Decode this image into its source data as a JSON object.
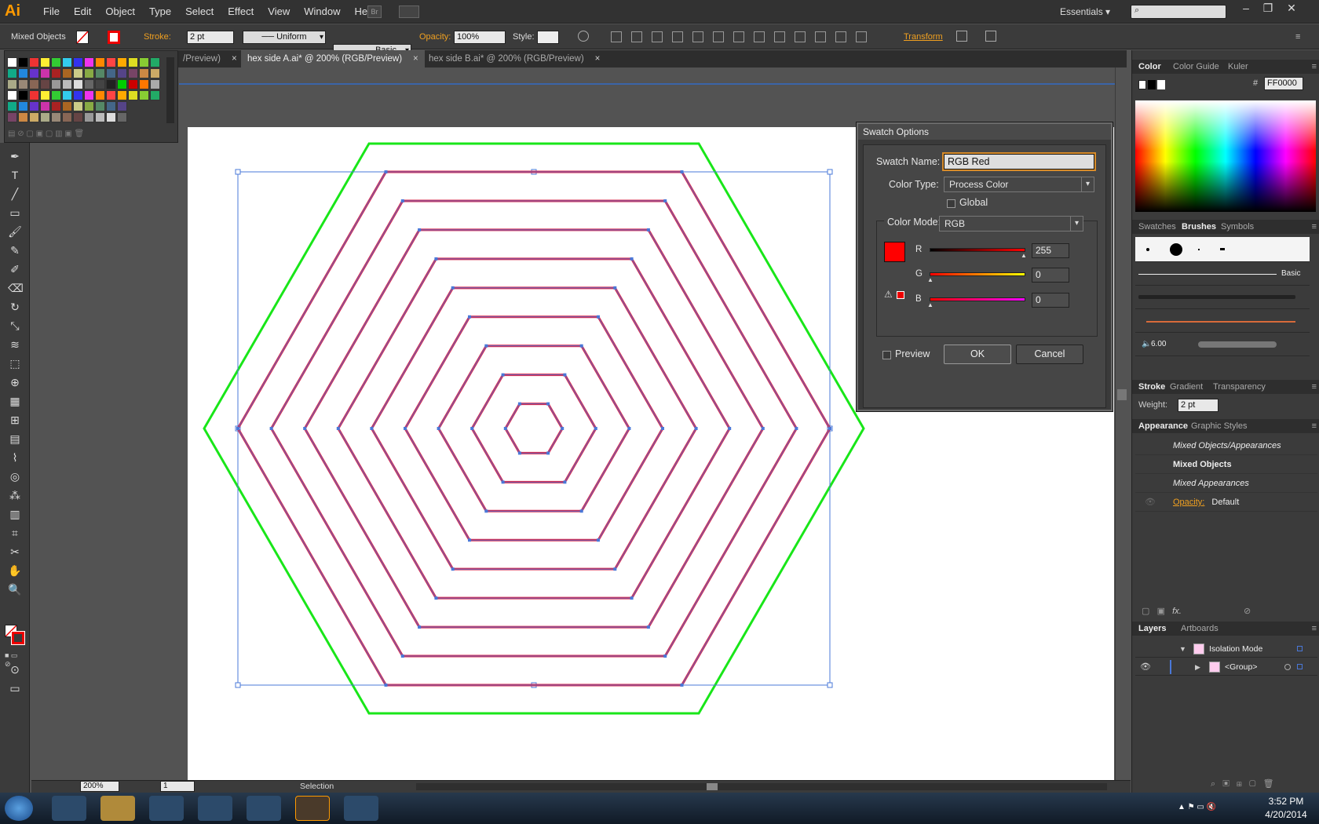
{
  "app": {
    "logo": "Ai",
    "menu": [
      "File",
      "Edit",
      "Object",
      "Type",
      "Select",
      "Effect",
      "View",
      "Window",
      "Help"
    ],
    "bridge_label": "Br",
    "workspace": "Essentials",
    "search_placeholder": ""
  },
  "control_bar": {
    "selection_type": "Mixed Objects",
    "stroke_label": "Stroke:",
    "stroke_weight": "2 pt",
    "profile": "Uniform",
    "brush": "Basic",
    "opacity_label": "Opacity:",
    "opacity": "100%",
    "style_label": "Style:",
    "transform_label": "Transform"
  },
  "tabs": [
    {
      "label": "/Preview)",
      "close": "×"
    },
    {
      "label": "hex side A.ai* @ 200% (RGB/Preview)",
      "close": "×"
    },
    {
      "label": "hex side B.ai* @ 200% (RGB/Preview)",
      "close": "×"
    }
  ],
  "dialog": {
    "title": "Swatch Options",
    "swatch_name_label": "Swatch Name:",
    "swatch_name": "RGB Red",
    "color_type_label": "Color Type:",
    "color_type": "Process Color",
    "global_label": "Global",
    "color_mode_label": "Color Mode:",
    "color_mode": "RGB",
    "r_label": "R",
    "r_value": "255",
    "g_label": "G",
    "g_value": "0",
    "b_label": "B",
    "b_value": "0",
    "preview_label": "Preview",
    "ok_label": "OK",
    "cancel_label": "Cancel",
    "swatch_color": "#ff0000"
  },
  "color_panel": {
    "tabs": [
      "Color",
      "Color Guide",
      "Kuler"
    ],
    "hex_label": "#",
    "hex_value": "FF0000"
  },
  "brushes_panel": {
    "tabs": [
      "Swatches",
      "Brushes",
      "Symbols"
    ],
    "basic_label": "Basic",
    "size_label": "6.00"
  },
  "stroke_panel": {
    "tabs": [
      "Stroke",
      "Gradient",
      "Transparency"
    ],
    "weight_label": "Weight:",
    "weight_value": "2 pt"
  },
  "appearance_panel": {
    "tabs": [
      "Appearance",
      "Graphic Styles"
    ],
    "rows": [
      "Mixed Objects/Appearances",
      "Mixed Objects",
      "Mixed Appearances"
    ],
    "opacity_label": "Opacity:",
    "opacity_value": "Default",
    "fx_label": "fx."
  },
  "layers_panel": {
    "tabs": [
      "Layers",
      "Artboards"
    ],
    "rows": [
      "Isolation Mode",
      "<Group>"
    ]
  },
  "status": {
    "zoom": "200%",
    "artboard": "1",
    "tool": "Selection"
  },
  "taskbar": {
    "time": "3:52 PM",
    "date": "4/20/2014"
  },
  "colors": {
    "hex_green": "#19e619",
    "hex_red": "#d8264a",
    "selection_blue": "#4a78d8"
  }
}
